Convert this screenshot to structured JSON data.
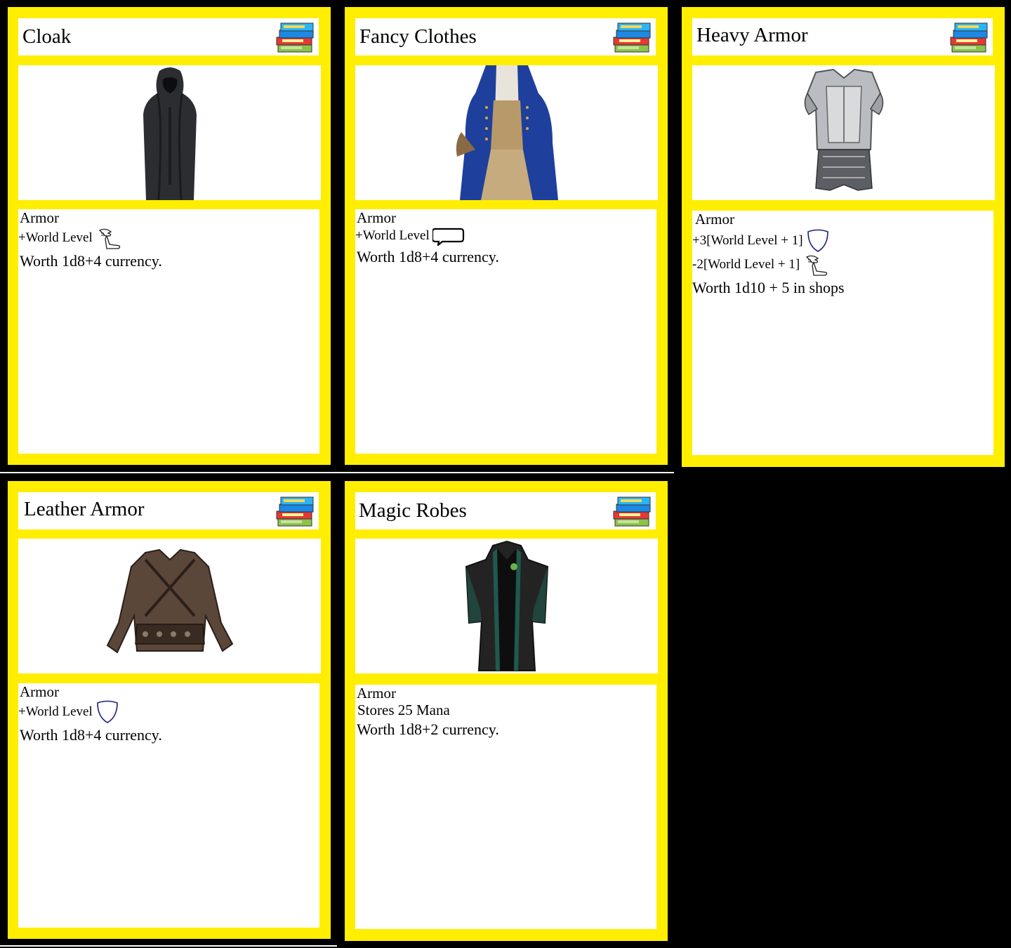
{
  "cards": [
    {
      "title": "Cloak",
      "type": "Armor",
      "lines": [
        "+World Level"
      ],
      "worth": "Worth 1d8+4 currency.",
      "line_icons": [
        "winged-boot-icon"
      ],
      "image": "cloak-image"
    },
    {
      "title": "Fancy Clothes",
      "type": "Armor",
      "lines": [
        "+World Level"
      ],
      "worth": "Worth 1d8+4 currency.",
      "line_icons": [
        "speech-bubble-icon"
      ],
      "image": "fancy-clothes-image"
    },
    {
      "title": "Heavy Armor",
      "type": "Armor",
      "lines": [
        "+3[World Level + 1]",
        "-2[World Level + 1]"
      ],
      "worth": "Worth 1d10 + 5 in shops",
      "line_icons": [
        "shield-icon",
        "winged-boot-icon"
      ],
      "image": "heavy-armor-image"
    },
    {
      "title": "Leather Armor",
      "type": "Armor",
      "lines": [
        "+World Level"
      ],
      "worth": "Worth 1d8+4 currency.",
      "line_icons": [
        "shield-icon"
      ],
      "image": "leather-armor-image"
    },
    {
      "title": "Magic Robes",
      "type": "Armor",
      "lines": [
        "Stores 25 Mana"
      ],
      "worth": "Worth 1d8+2 currency.",
      "line_icons": [],
      "image": "magic-robes-image"
    }
  ],
  "colors": {
    "card_border": "#ffee00",
    "background": "#000000",
    "panel": "#ffffff"
  }
}
